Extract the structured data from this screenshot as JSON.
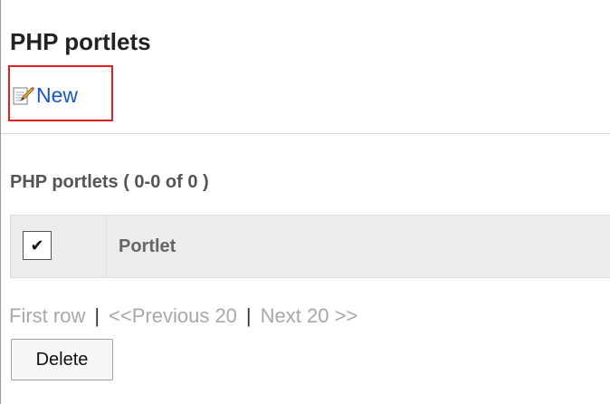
{
  "page": {
    "title": "PHP portlets"
  },
  "actions": {
    "new_label": "New",
    "new_icon": "edit-icon"
  },
  "list": {
    "title": "PHP portlets ( 0-0 of 0 )",
    "check_all_glyph": "✔",
    "columns": [
      "Portlet"
    ]
  },
  "pager": {
    "first": "First row",
    "separator": "|",
    "previous": "<<Previous 20",
    "next": "Next 20 >>"
  },
  "buttons": {
    "delete_label": "Delete"
  },
  "colors": {
    "link": "#1a55c8",
    "highlight_box": "#e02020",
    "disabled_link": "#a8a8a8"
  }
}
